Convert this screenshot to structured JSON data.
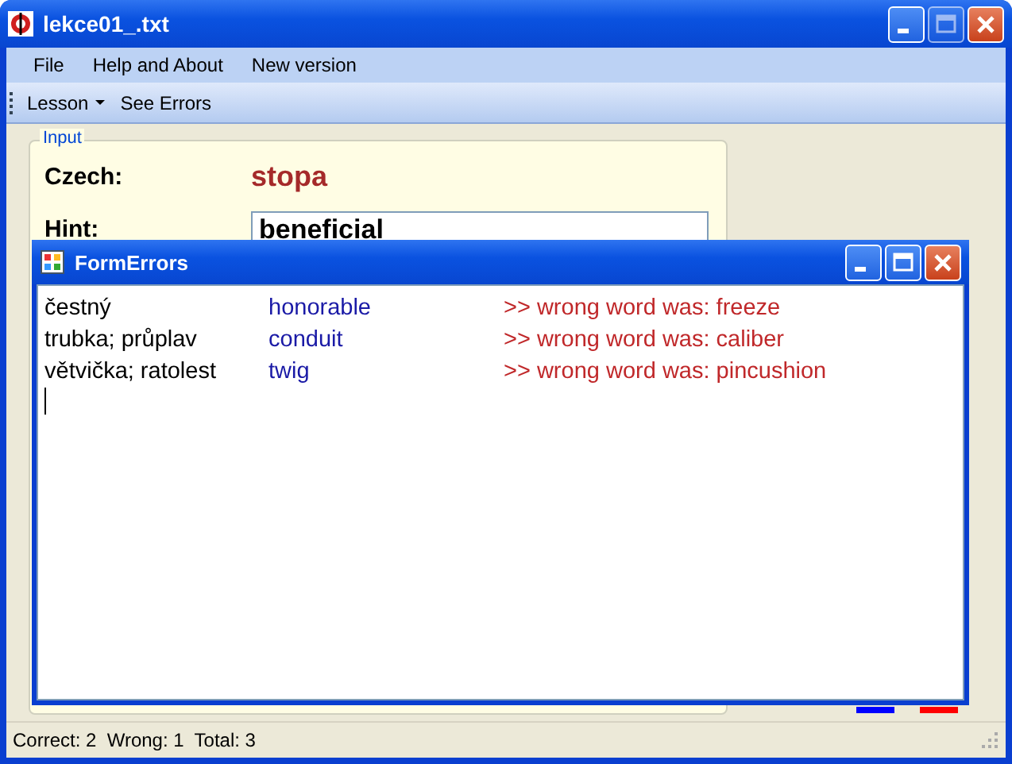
{
  "window": {
    "title": "lekce01_.txt"
  },
  "menu": [
    "File",
    "Help and About",
    "New version"
  ],
  "toolbar": {
    "dropdown": "Lesson",
    "button": "See Errors"
  },
  "input_group": {
    "title": "Input",
    "czech_label": "Czech:",
    "czech_word": "stopa",
    "hint_label": "Hint:",
    "hint_value": "beneficial"
  },
  "errors_window": {
    "title": "FormErrors",
    "rows": [
      {
        "czech": "čestný",
        "english": "honorable",
        "error": ">> wrong word was: freeze"
      },
      {
        "czech": "trubka; průplav",
        "english": "conduit",
        "error": ">> wrong word was: caliber"
      },
      {
        "czech": "větvička; ratolest",
        "english": "twig",
        "error": ">> wrong word was: pincushion"
      }
    ]
  },
  "legend": [
    {
      "color": "#0000ff"
    },
    {
      "color": "#ff0000"
    }
  ],
  "status_bar": "Correct: 2  Wrong: 1  Total: 3"
}
